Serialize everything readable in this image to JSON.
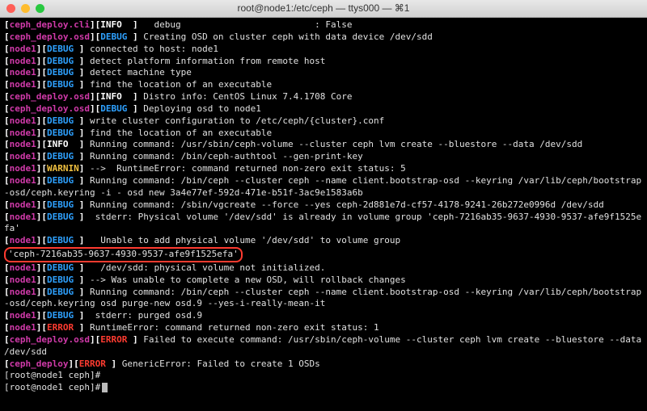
{
  "titlebar": {
    "title": "root@node1:/etc/ceph — ttys000 — ⌘1"
  },
  "prompt": "[root@node1 ceph]#",
  "lines": [
    {
      "src": "ceph_deploy.cli",
      "lvl": "INFO",
      "txt": "  debug                         : False"
    },
    {
      "src": "ceph_deploy.osd",
      "lvl": "DEBUG",
      "txt": "Creating OSD on cluster ceph with data device /dev/sdd"
    },
    {
      "src": "node1",
      "lvl": "DEBUG",
      "txt": "connected to host: node1"
    },
    {
      "src": "node1",
      "lvl": "DEBUG",
      "txt": "detect platform information from remote host"
    },
    {
      "src": "node1",
      "lvl": "DEBUG",
      "txt": "detect machine type"
    },
    {
      "src": "node1",
      "lvl": "DEBUG",
      "txt": "find the location of an executable"
    },
    {
      "src": "ceph_deploy.osd",
      "lvl": "INFO",
      "txt": "Distro info: CentOS Linux 7.4.1708 Core"
    },
    {
      "src": "ceph_deploy.osd",
      "lvl": "DEBUG",
      "txt": "Deploying osd to node1"
    },
    {
      "src": "node1",
      "lvl": "DEBUG",
      "txt": "write cluster configuration to /etc/ceph/{cluster}.conf"
    },
    {
      "src": "node1",
      "lvl": "DEBUG",
      "txt": "find the location of an executable"
    },
    {
      "src": "node1",
      "lvl": "INFO",
      "txt": "Running command: /usr/sbin/ceph-volume --cluster ceph lvm create --bluestore --data /dev/sdd"
    },
    {
      "src": "node1",
      "lvl": "DEBUG",
      "txt": "Running command: /bin/ceph-authtool --gen-print-key"
    },
    {
      "src": "node1",
      "lvl": "WARNIN",
      "txt": "-->  RuntimeError: command returned non-zero exit status: 5"
    },
    {
      "src": "node1",
      "lvl": "DEBUG",
      "txt": "Running command: /bin/ceph --cluster ceph --name client.bootstrap-osd --keyring /var/lib/ceph/bootstrap-osd/ceph.keyring -i - osd new 3a4e77ef-592d-471e-b51f-3ac9e1583a6b",
      "wrap": true
    },
    {
      "src": "node1",
      "lvl": "DEBUG",
      "txt": "Running command: /sbin/vgcreate --force --yes ceph-2d881e7d-cf57-4178-9241-26b272e0996d /dev/sdd"
    },
    {
      "src": "node1",
      "lvl": "DEBUG",
      "txt": " stderr: Physical volume '/dev/sdd' is already in volume group 'ceph-7216ab35-9637-4930-9537-afe9f1525efa'",
      "wrap": true,
      "trail": "a'"
    },
    {
      "src": "node1",
      "lvl": "DEBUG",
      "txt_pre": "  Unable to add physical volume '/dev/sdd' to volume group ",
      "highlight": "'ceph-7216ab35-9637-4930-9537-afe9f1525efa'"
    },
    {
      "src": "node1",
      "lvl": "DEBUG",
      "txt": "  /dev/sdd: physical volume not initialized."
    },
    {
      "src": "node1",
      "lvl": "DEBUG",
      "txt": "--> Was unable to complete a new OSD, will rollback changes"
    },
    {
      "src": "node1",
      "lvl": "DEBUG",
      "txt": "Running command: /bin/ceph --cluster ceph --name client.bootstrap-osd --keyring /var/lib/ceph/bootstrap-osd/ceph.keyring osd purge-new osd.9 --yes-i-really-mean-it",
      "wrap": true
    },
    {
      "src": "node1",
      "lvl": "DEBUG",
      "txt": " stderr: purged osd.9"
    },
    {
      "src": "node1",
      "lvl": "ERROR",
      "txt": "RuntimeError: command returned non-zero exit status: 1"
    },
    {
      "src": "ceph_deploy.osd",
      "lvl": "ERROR",
      "txt": "Failed to execute command: /usr/sbin/ceph-volume --cluster ceph lvm create --bluestore --data /dev/sdd",
      "wrap": true
    },
    {
      "src": "ceph_deploy",
      "lvl": "ERROR",
      "txt": "GenericError: Failed to create 1 OSDs"
    }
  ]
}
